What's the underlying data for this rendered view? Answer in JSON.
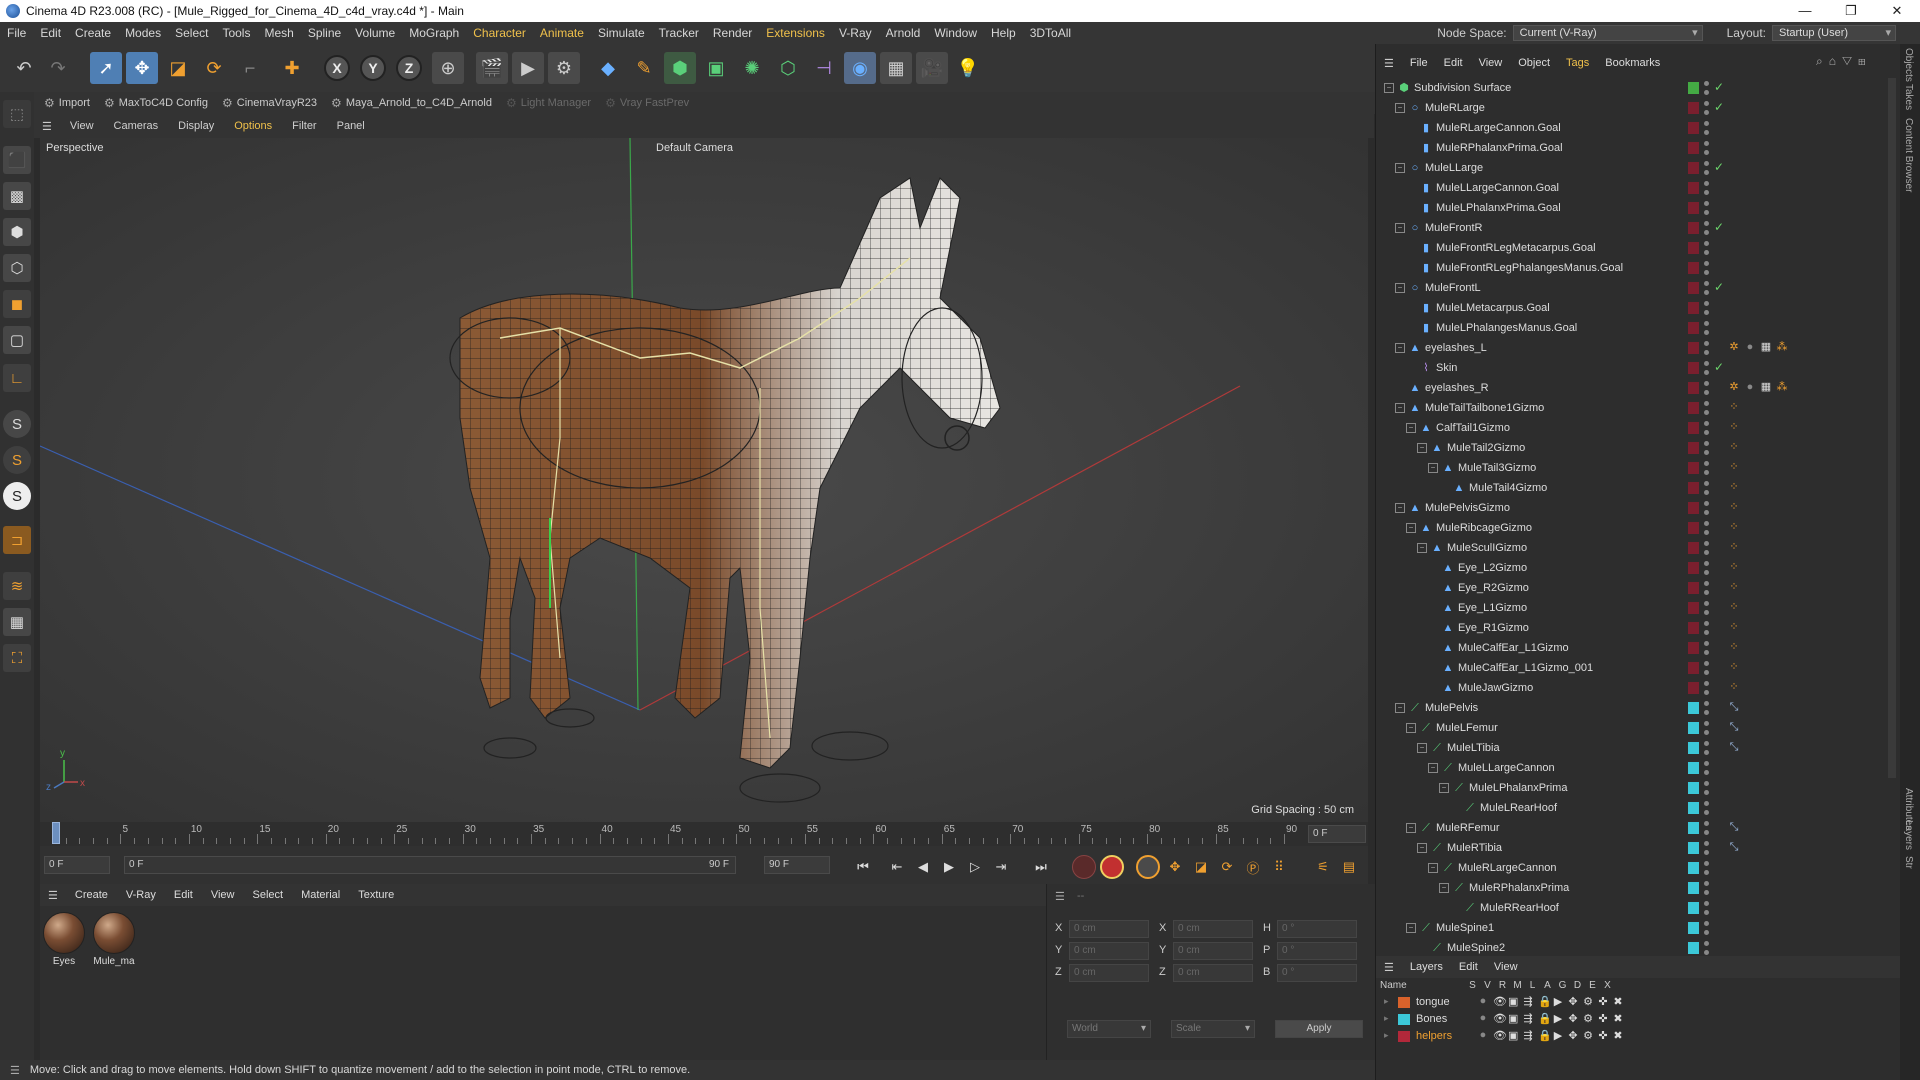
{
  "window": {
    "title": "Cinema 4D R23.008 (RC) - [Mule_Rigged_for_Cinema_4D_c4d_vray.c4d *] - Main",
    "controls": [
      "—",
      "❐",
      "✕"
    ]
  },
  "menubar": {
    "items": [
      "File",
      "Edit",
      "Create",
      "Modes",
      "Select",
      "Tools",
      "Mesh",
      "Spline",
      "Volume",
      "MoGraph",
      "Character",
      "Animate",
      "Simulate",
      "Tracker",
      "Render",
      "Extensions",
      "V-Ray",
      "Arnold",
      "Window",
      "Help",
      "3DToAll"
    ],
    "highlighted": [
      "Character",
      "Animate",
      "Extensions"
    ],
    "node_space_label": "Node Space:",
    "node_space_value": "Current (V-Ray)",
    "layout_label": "Layout:",
    "layout_value": "Startup (User)"
  },
  "pluginbar": {
    "items": [
      {
        "label": "Import",
        "enabled": true
      },
      {
        "label": "MaxToC4D Config",
        "enabled": true
      },
      {
        "label": "CinemaVrayR23",
        "enabled": true
      },
      {
        "label": "Maya_Arnold_to_C4D_Arnold",
        "enabled": true
      },
      {
        "label": "Light Manager",
        "enabled": false
      },
      {
        "label": "Vray FastPrev",
        "enabled": false
      }
    ]
  },
  "viewport": {
    "menu": [
      "View",
      "Cameras",
      "Display",
      "Options",
      "Filter",
      "Panel"
    ],
    "menu_highlight": "Options",
    "label": "Perspective",
    "camera": "Default Camera",
    "grid_spacing": "Grid Spacing : 50 cm"
  },
  "timeline": {
    "ticks": [
      "0",
      "5",
      "10",
      "15",
      "20",
      "25",
      "30",
      "35",
      "40",
      "45",
      "50",
      "55",
      "60",
      "65",
      "70",
      "75",
      "80",
      "85",
      "90"
    ],
    "current_frame": "0 F",
    "start_field": "0 F",
    "range_start": "0 F",
    "range_end": "90 F",
    "end_field": "90 F"
  },
  "materials": {
    "menu": [
      "Create",
      "V-Ray",
      "Edit",
      "View",
      "Select",
      "Material",
      "Texture"
    ],
    "items": [
      "Eyes",
      "Mule_ma"
    ]
  },
  "coordinates": {
    "header": "--",
    "rows": [
      {
        "a": "X",
        "av": "0 cm",
        "b": "X",
        "bv": "0 cm",
        "c": "H",
        "cv": "0 °"
      },
      {
        "a": "Y",
        "av": "0 cm",
        "b": "Y",
        "bv": "0 cm",
        "c": "P",
        "cv": "0 °"
      },
      {
        "a": "Z",
        "av": "0 cm",
        "b": "Z",
        "bv": "0 cm",
        "c": "B",
        "cv": "0 °"
      }
    ],
    "mode1": "World",
    "mode2": "Scale",
    "apply": "Apply"
  },
  "status": "Move: Click and drag to move elements. Hold down SHIFT to quantize movement / add to the selection in point mode, CTRL to remove.",
  "object_manager": {
    "menu": [
      "File",
      "Edit",
      "View",
      "Object",
      "Tags",
      "Bookmarks"
    ],
    "menu_highlight": "Tags",
    "objects": [
      {
        "name": "Subdivision Surface",
        "depth": 0,
        "icon": "subdivision-icon",
        "color": "#44aa44",
        "check": true
      },
      {
        "name": "MuleRLarge",
        "depth": 1,
        "icon": "null-icon",
        "color": "#7a1f2e",
        "check": true
      },
      {
        "name": "MuleRLargeCannon.Goal",
        "depth": 2,
        "icon": "goal-icon",
        "color": "#7a1f2e",
        "check": false
      },
      {
        "name": "MuleRPhalanxPrima.Goal",
        "depth": 2,
        "icon": "goal-icon",
        "color": "#7a1f2e",
        "check": false
      },
      {
        "name": "MuleLLarge",
        "depth": 1,
        "icon": "null-icon",
        "color": "#7a1f2e",
        "check": true
      },
      {
        "name": "MuleLLargeCannon.Goal",
        "depth": 2,
        "icon": "goal-icon",
        "color": "#7a1f2e",
        "check": false
      },
      {
        "name": "MuleLPhalanxPrima.Goal",
        "depth": 2,
        "icon": "goal-icon",
        "color": "#7a1f2e",
        "check": false
      },
      {
        "name": "MuleFrontR",
        "depth": 1,
        "icon": "null-icon",
        "color": "#7a1f2e",
        "check": true
      },
      {
        "name": "MuleFrontRLegMetacarpus.Goal",
        "depth": 2,
        "icon": "goal-icon",
        "color": "#7a1f2e",
        "check": false
      },
      {
        "name": "MuleFrontRLegPhalangesManus.Goal",
        "depth": 2,
        "icon": "goal-icon",
        "color": "#7a1f2e",
        "check": false
      },
      {
        "name": "MuleFrontL",
        "depth": 1,
        "icon": "null-icon",
        "color": "#7a1f2e",
        "check": true
      },
      {
        "name": "MuleLMetacarpus.Goal",
        "depth": 2,
        "icon": "goal-icon",
        "color": "#7a1f2e",
        "check": false
      },
      {
        "name": "MuleLPhalangesManus.Goal",
        "depth": 2,
        "icon": "goal-icon",
        "color": "#7a1f2e",
        "check": false
      },
      {
        "name": "eyelashes_L",
        "depth": 1,
        "icon": "mesh-icon",
        "color": "#7a1f2e",
        "check": false,
        "tags": true
      },
      {
        "name": "Skin",
        "depth": 2,
        "icon": "skin-icon",
        "color": "#7a1f2e",
        "check": true
      },
      {
        "name": "eyelashes_R",
        "depth": 1,
        "icon": "mesh-icon",
        "color": "#7a1f2e",
        "check": false,
        "tags": true
      },
      {
        "name": "MuleTailTailbone1Gizmo",
        "depth": 1,
        "icon": "mesh-icon",
        "color": "#7a1f2e",
        "check": false,
        "dot": true
      },
      {
        "name": "CalfTail1Gizmo",
        "depth": 2,
        "icon": "mesh-icon",
        "color": "#7a1f2e",
        "check": false,
        "dot": true
      },
      {
        "name": "MuleTail2Gizmo",
        "depth": 3,
        "icon": "mesh-icon",
        "color": "#7a1f2e",
        "check": false,
        "dot": true
      },
      {
        "name": "MuleTail3Gizmo",
        "depth": 4,
        "icon": "mesh-icon",
        "color": "#7a1f2e",
        "check": false,
        "dot": true
      },
      {
        "name": "MuleTail4Gizmo",
        "depth": 5,
        "icon": "mesh-icon",
        "color": "#7a1f2e",
        "check": false,
        "dot": true
      },
      {
        "name": "MulePelvisGizmo",
        "depth": 1,
        "icon": "mesh-icon",
        "color": "#7a1f2e",
        "check": false,
        "dot": true
      },
      {
        "name": "MuleRibcageGizmo",
        "depth": 2,
        "icon": "mesh-icon",
        "color": "#7a1f2e",
        "check": false,
        "dot": true
      },
      {
        "name": "MuleSculIGizmo",
        "depth": 3,
        "icon": "mesh-icon",
        "color": "#7a1f2e",
        "check": false,
        "dot": true
      },
      {
        "name": "Eye_L2Gizmo",
        "depth": 4,
        "icon": "mesh-icon",
        "color": "#7a1f2e",
        "check": false,
        "dot": true
      },
      {
        "name": "Eye_R2Gizmo",
        "depth": 4,
        "icon": "mesh-icon",
        "color": "#7a1f2e",
        "check": false,
        "dot": true
      },
      {
        "name": "Eye_L1Gizmo",
        "depth": 4,
        "icon": "mesh-icon",
        "color": "#7a1f2e",
        "check": false,
        "dot": true
      },
      {
        "name": "Eye_R1Gizmo",
        "depth": 4,
        "icon": "mesh-icon",
        "color": "#7a1f2e",
        "check": false,
        "dot": true
      },
      {
        "name": "MuleCalfEar_L1Gizmo",
        "depth": 4,
        "icon": "mesh-icon",
        "color": "#7a1f2e",
        "check": false,
        "dot": true
      },
      {
        "name": "MuleCalfEar_L1Gizmo_001",
        "depth": 4,
        "icon": "mesh-icon",
        "color": "#7a1f2e",
        "check": false,
        "dot": true
      },
      {
        "name": "MuleJawGizmo",
        "depth": 4,
        "icon": "mesh-icon",
        "color": "#7a1f2e",
        "check": false,
        "dot": true
      },
      {
        "name": "MulePelvis",
        "depth": 1,
        "icon": "joint-icon",
        "color": "#3cc8d8",
        "check": false,
        "ik": true
      },
      {
        "name": "MuleLFemur",
        "depth": 2,
        "icon": "joint-icon",
        "color": "#3cc8d8",
        "check": false,
        "ik": true
      },
      {
        "name": "MuleLTibia",
        "depth": 3,
        "icon": "joint-icon",
        "color": "#3cc8d8",
        "check": false,
        "ik": true
      },
      {
        "name": "MuleLLargeCannon",
        "depth": 4,
        "icon": "joint-icon",
        "color": "#3cc8d8",
        "check": false
      },
      {
        "name": "MuleLPhalanxPrima",
        "depth": 5,
        "icon": "joint-icon",
        "color": "#3cc8d8",
        "check": false
      },
      {
        "name": "MuleLRearHoof",
        "depth": 6,
        "icon": "joint-icon",
        "color": "#3cc8d8",
        "check": false
      },
      {
        "name": "MuleRFemur",
        "depth": 2,
        "icon": "joint-icon",
        "color": "#3cc8d8",
        "check": false,
        "ik": true
      },
      {
        "name": "MuleRTibia",
        "depth": 3,
        "icon": "joint-icon",
        "color": "#3cc8d8",
        "check": false,
        "ik": true
      },
      {
        "name": "MuleRLargeCannon",
        "depth": 4,
        "icon": "joint-icon",
        "color": "#3cc8d8",
        "check": false
      },
      {
        "name": "MuleRPhalanxPrima",
        "depth": 5,
        "icon": "joint-icon",
        "color": "#3cc8d8",
        "check": false
      },
      {
        "name": "MuleRRearHoof",
        "depth": 6,
        "icon": "joint-icon",
        "color": "#3cc8d8",
        "check": false
      },
      {
        "name": "MuleSpine1",
        "depth": 2,
        "icon": "joint-icon",
        "color": "#3cc8d8",
        "check": false
      },
      {
        "name": "MuleSpine2",
        "depth": 3,
        "icon": "joint-icon",
        "color": "#3cc8d8",
        "check": false
      }
    ]
  },
  "layers": {
    "menu": [
      "Layers",
      "Edit",
      "View"
    ],
    "header": {
      "name": "Name",
      "cols": [
        "S",
        "V",
        "R",
        "M",
        "L",
        "A",
        "G",
        "D",
        "E",
        "X"
      ]
    },
    "items": [
      {
        "name": "tongue",
        "color": "#d9622b",
        "active": false
      },
      {
        "name": "Bones",
        "color": "#3cc8d8",
        "active": false
      },
      {
        "name": "helpers",
        "color": "#b2283a",
        "active": true
      }
    ]
  },
  "side_tabs": [
    "Objects",
    "Takes",
    "Content Browser",
    "Attributes",
    "Layers",
    "Str"
  ]
}
